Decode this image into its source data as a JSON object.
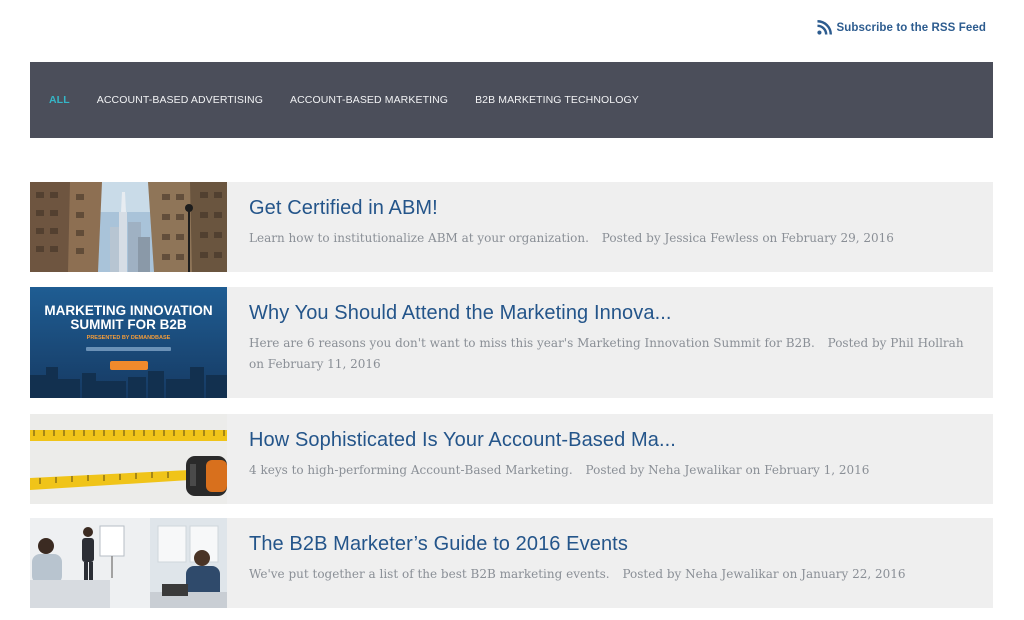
{
  "rss": {
    "label": "Subscribe to the RSS Feed",
    "icon": "rss-icon"
  },
  "nav": {
    "items": [
      {
        "label": "ALL",
        "active": true
      },
      {
        "label": "ACCOUNT-BASED ADVERTISING",
        "active": false
      },
      {
        "label": "ACCOUNT-BASED MARKETING",
        "active": false
      },
      {
        "label": "B2B MARKETING TECHNOLOGY",
        "active": false
      }
    ]
  },
  "posts": [
    {
      "title": "Get Certified in ABM!",
      "excerpt": "Learn how to institutionalize ABM at your organization.",
      "byline": "Posted by Jessica Fewless on February 29, 2016"
    },
    {
      "title": "Why You Should Attend the Marketing Innova...",
      "excerpt": "Here are 6 reasons you don't want to miss this year's Marketing Innovation Summit for B2B.",
      "byline": "Posted by Phil Hollrah on February 11, 2016",
      "image_text": {
        "line1": "MARKETING INNOVATION",
        "line2": "SUMMIT FOR B2B",
        "line3": "PRESENTED BY DEMANDBASE"
      }
    },
    {
      "title": "How Sophisticated Is Your Account-Based Ma...",
      "excerpt": "4 keys to high-performing Account-Based Marketing.",
      "byline": "Posted by Neha Jewalikar on February 1, 2016"
    },
    {
      "title": "The B2B Marketer’s Guide to 2016 Events",
      "excerpt": "We've put together a list of the best B2B marketing events.",
      "byline": "Posted by Neha Jewalikar on January 22, 2016"
    }
  ],
  "colors": {
    "nav_bg": "#4b4e5a",
    "nav_active": "#35b6c7",
    "title": "#24558a",
    "meta": "#8a8f96",
    "card_bg": "#efefef",
    "rss": "#2d5c8f"
  }
}
